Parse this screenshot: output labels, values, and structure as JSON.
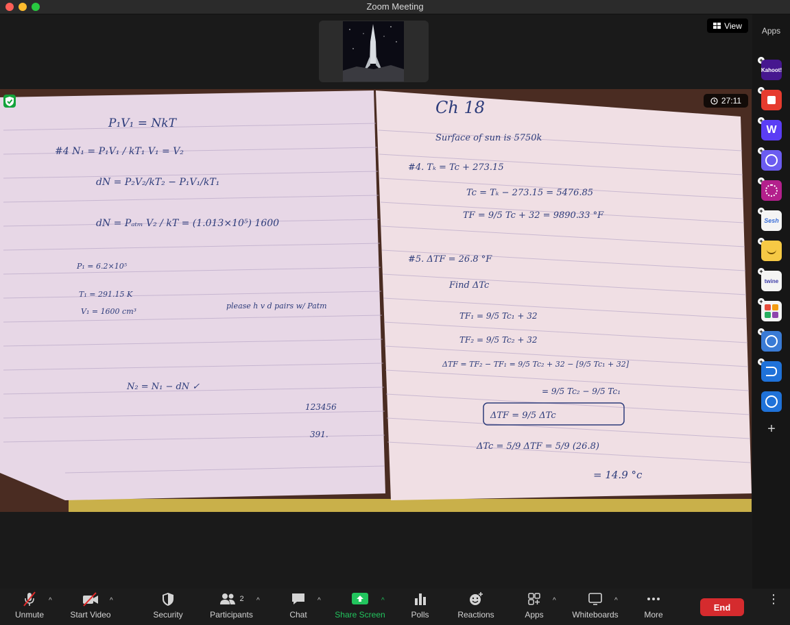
{
  "window": {
    "title": "Zoom Meeting"
  },
  "view_button": {
    "label": "View",
    "icon": "grid-icon"
  },
  "timer": {
    "value": "27:11",
    "icon": "clock-icon"
  },
  "apps_sidebar": {
    "label": "Apps",
    "items": [
      {
        "name": "Kahoot!",
        "text": "Kahoot!",
        "color": "#46178f"
      },
      {
        "name": "red-app",
        "text": "",
        "color": "#e63b2e"
      },
      {
        "name": "W",
        "text": "W",
        "color": "#5b3df5"
      },
      {
        "name": "blue-chat",
        "text": "",
        "color": "#6b5cf0"
      },
      {
        "name": "spiral",
        "text": "",
        "color": "#b3208c"
      },
      {
        "name": "Sesh",
        "text": "Sesh",
        "color": "#f4f4f4"
      },
      {
        "name": "smile",
        "text": "",
        "color": "#f6c945"
      },
      {
        "name": "twine",
        "text": "twine",
        "color": "#f4f4f4"
      },
      {
        "name": "grid-app",
        "text": "",
        "color": "#f4f4f4"
      },
      {
        "name": "sync",
        "text": "",
        "color": "#3a7bd5"
      },
      {
        "name": "edge",
        "text": "",
        "color": "#1f72d9"
      },
      {
        "name": "clock-app",
        "text": "",
        "color": "#1f72d9"
      }
    ]
  },
  "notes": {
    "left": [
      "P₁V₁ = NkT",
      "#4  N₁ = P₁V₁ / kT₁      V₁ = V₂",
      "dN = P₂V₂/kT₂ − P₁V₁/kT₁",
      "dN = Pₐₜₘ V₂ / kT  = (1.013×10⁵) 1600",
      "P₁ = 6.2×10⁵",
      "T₁ = 291.15 K",
      "V₁ = 1600 cm³",
      "please h v d pairs w/ Patm",
      "N₂ = N₁ − dN ✓",
      "123456",
      "391."
    ],
    "right": [
      "Ch 18",
      "Surface of sun is 5750k",
      "#4.  Tₖ = Tc + 273.15",
      "Tc = Tₖ − 273.15 = 5476.85",
      "TF = 9/5 Tc + 32 = 9890.33 °F",
      "#5.  ΔTF = 26.8 °F",
      "Find ΔTc",
      "TF₁ = 9/5 Tc₁ + 32",
      "TF₂ = 9/5 Tc₂ + 32",
      "ΔTF = TF₂ − TF₁ = 9/5 Tc₂ + 32 − [9/5 Tc₁ + 32]",
      "= 9/5 Tc₂ − 9/5 Tc₁",
      "ΔTF = 9/5 ΔTc",
      "ΔTc = 5/9 ΔTF = 5/9 (26.8)",
      "= 14.9 °c"
    ]
  },
  "toolbar": {
    "unmute": "Unmute",
    "start_video": "Start Video",
    "security": "Security",
    "participants": "Participants",
    "participants_count": "2",
    "chat": "Chat",
    "share_screen": "Share Screen",
    "polls": "Polls",
    "reactions": "Reactions",
    "apps": "Apps",
    "whiteboards": "Whiteboards",
    "more": "More",
    "end": "End"
  },
  "colors": {
    "share_green": "#22c55e",
    "end_red": "#d52b2e",
    "security_green": "#14a33b"
  }
}
